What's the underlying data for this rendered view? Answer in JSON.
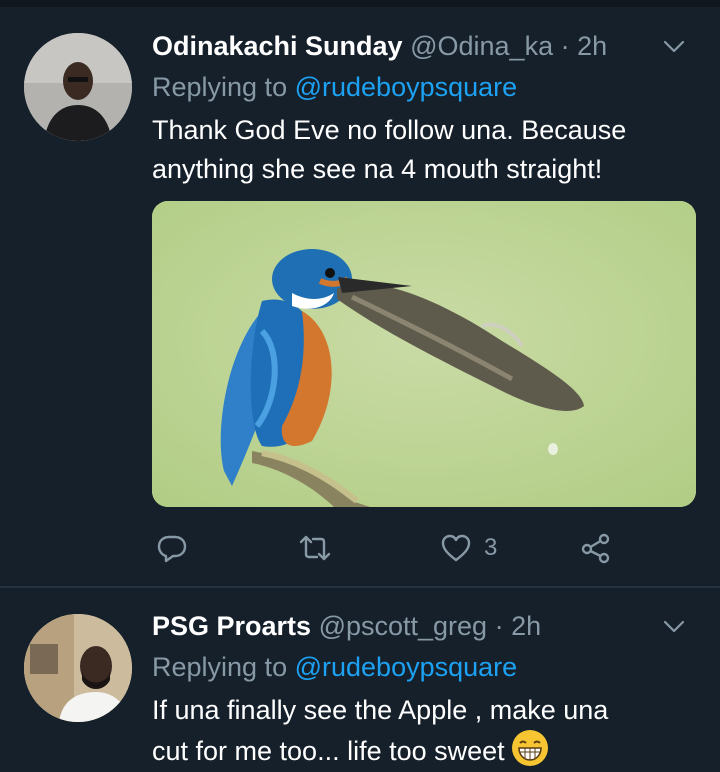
{
  "tweets": [
    {
      "name": "Odinakachi Sunday",
      "handle": "@Odina_ka",
      "time": "2h",
      "replying_prefix": "Replying to",
      "replying_to": "@rudeboypsquare",
      "text_line1": "Thank God Eve no follow una. Because",
      "text_line2": "anything she see na 4 mouth straight!",
      "like_count": "3"
    },
    {
      "name": "PSG Proarts",
      "handle": "@pscott_greg",
      "time": "2h",
      "replying_prefix": "Replying to",
      "replying_to": "@rudeboypsquare",
      "text_line1": "If una finally see the Apple , make una",
      "text_line2": "cut for me too... life too sweet"
    }
  ],
  "colors": {
    "background": "#15202b",
    "secondary_text": "#8899a6",
    "mention": "#1da1f2"
  },
  "icons": [
    "chevron-down-icon",
    "reply-icon",
    "retweet-icon",
    "like-icon",
    "share-icon",
    "grinning-emoji-icon"
  ]
}
